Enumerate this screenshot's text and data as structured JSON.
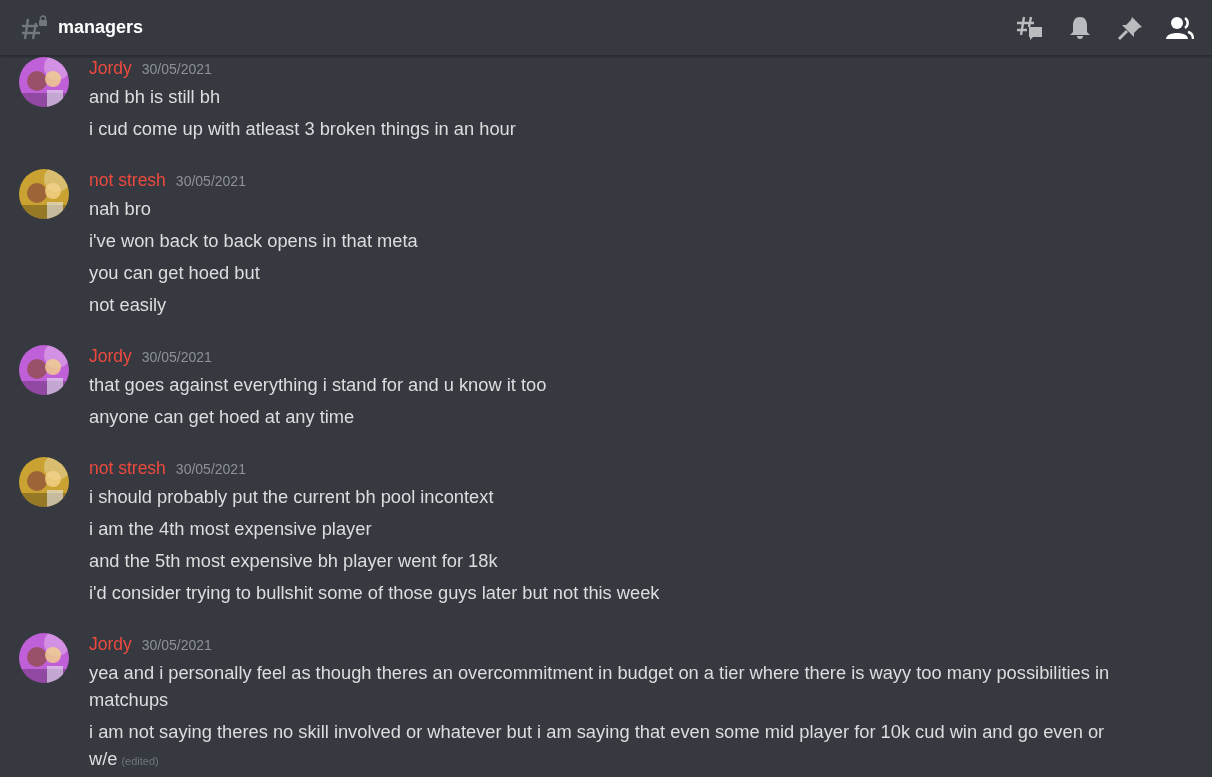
{
  "channel": {
    "name": "managers"
  },
  "groups": [
    {
      "author": "Jordy",
      "avatar": {
        "kind": "picture",
        "color": "#c060d8"
      },
      "timestamp": "30/05/2021",
      "messages": [
        {
          "text": "and bh is still bh"
        },
        {
          "text": "i cud come up with atleast 3 broken things in an hour"
        }
      ]
    },
    {
      "author": "not stresh",
      "avatar": {
        "kind": "picture",
        "color": "#c9a232"
      },
      "timestamp": "30/05/2021",
      "messages": [
        {
          "text": "nah bro"
        },
        {
          "text": "i've won back to back opens in that meta"
        },
        {
          "text": "you can get hoed but"
        },
        {
          "text": "not easily"
        }
      ]
    },
    {
      "author": "Jordy",
      "avatar": {
        "kind": "picture",
        "color": "#c060d8"
      },
      "timestamp": "30/05/2021",
      "messages": [
        {
          "text": "that goes against everything i stand for and u know it too"
        },
        {
          "text": "anyone can get hoed at any time"
        }
      ]
    },
    {
      "author": "not stresh",
      "avatar": {
        "kind": "picture",
        "color": "#c9a232"
      },
      "timestamp": "30/05/2021",
      "messages": [
        {
          "text": "i should probably put the current bh pool incontext"
        },
        {
          "text": "i am the 4th most expensive player"
        },
        {
          "text": "and the 5th most expensive bh player went for 18k"
        },
        {
          "text": "i'd consider trying to bullshit some of those guys later but not this week"
        }
      ]
    },
    {
      "author": "Jordy",
      "avatar": {
        "kind": "picture",
        "color": "#c060d8"
      },
      "timestamp": "30/05/2021",
      "messages": [
        {
          "text": "yea and i personally feel as though theres an overcommitment in budget on a tier where there is wayy too many possibilities in matchups"
        },
        {
          "text": "i am not saying theres no skill involved or whatever but i am saying that even some mid player for 10k cud win and go even or w/e",
          "edited": "(edited)"
        }
      ]
    }
  ]
}
